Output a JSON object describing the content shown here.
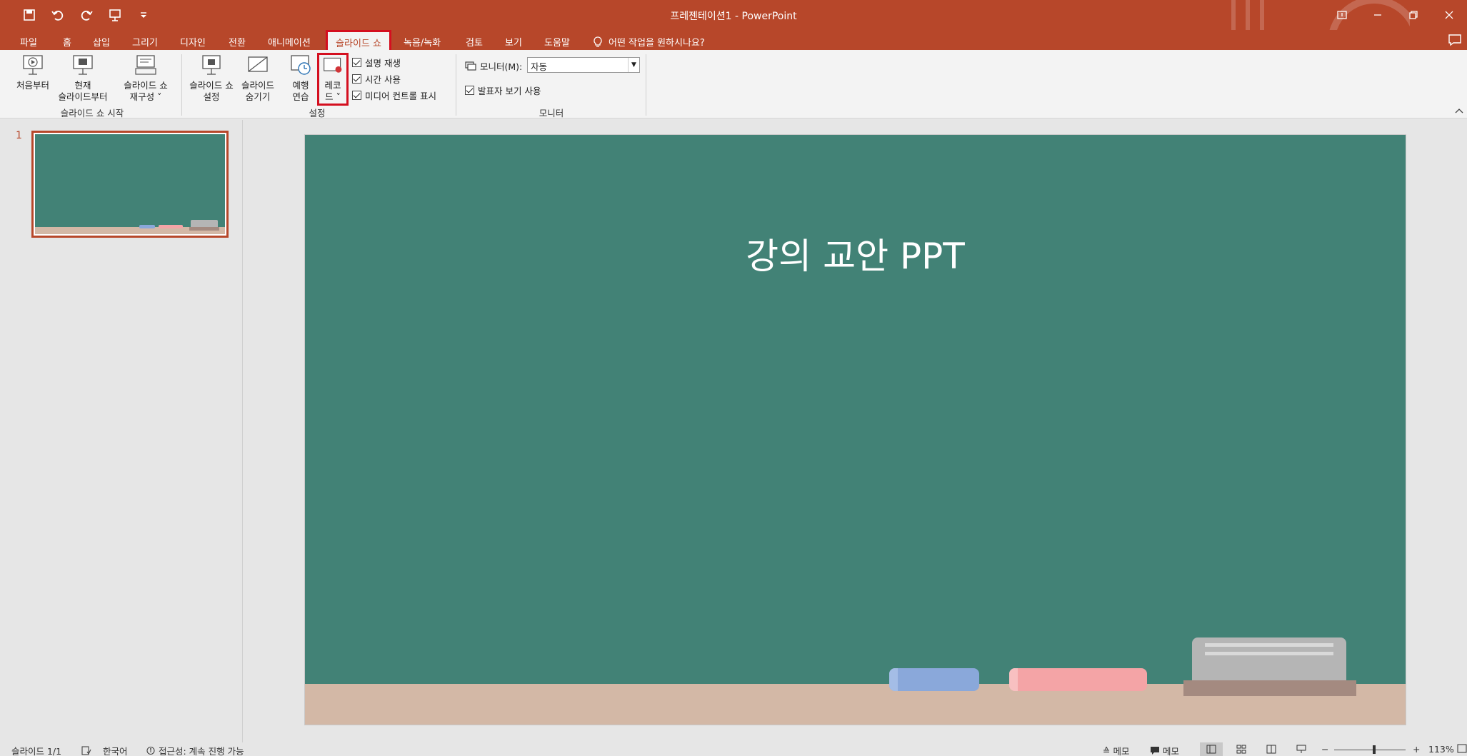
{
  "window": {
    "title": "프레젠테이션1  -  PowerPoint"
  },
  "quick_access": [
    "save-icon",
    "undo-icon",
    "redo-icon",
    "present-from-start-icon",
    "customize-qat-icon"
  ],
  "tabs": [
    {
      "label": "파일"
    },
    {
      "label": "홈"
    },
    {
      "label": "삽입"
    },
    {
      "label": "그리기"
    },
    {
      "label": "디자인"
    },
    {
      "label": "전환"
    },
    {
      "label": "애니메이션"
    },
    {
      "label": "슬라이드 쇼",
      "active": true
    },
    {
      "label": "녹음/녹화"
    },
    {
      "label": "검토"
    },
    {
      "label": "보기"
    },
    {
      "label": "도움말"
    }
  ],
  "tell_me": "어떤 작업을 원하시나요?",
  "ribbon": {
    "start_group": {
      "label": "슬라이드 쇼 시작",
      "from_beginning": "처음부터",
      "from_current_1": "현재",
      "from_current_2": "슬라이드부터",
      "custom_1": "슬라이드 쇼",
      "custom_2": "재구성 ˅"
    },
    "setup_group": {
      "label": "설정",
      "setup_1": "슬라이드 쇼",
      "setup_2": "설정",
      "hide_1": "슬라이드",
      "hide_2": "숨기기",
      "rehearse_1": "예행",
      "rehearse_2": "연습",
      "record_1": "레코",
      "record_2": "드 ˅",
      "play_narrations": "설명 재생",
      "use_timings": "시간 사용",
      "show_media_controls": "미디어 컨트롤 표시"
    },
    "monitor_group": {
      "label": "모니터",
      "monitor_label": "모니터(M):",
      "monitor_value": "자동",
      "presenter_view": "발표자 보기 사용"
    }
  },
  "thumbnails": [
    {
      "number": "1"
    }
  ],
  "slide": {
    "title": "강의 교안 PPT"
  },
  "statusbar": {
    "slide_count": "슬라이드 1/1",
    "language": "한국어",
    "accessibility": "접근성: 계속 진행 가능",
    "notes": "메모",
    "comments": "메모",
    "zoom_minus": "−",
    "zoom_plus": "+",
    "zoom": "113%"
  },
  "colors": {
    "accent": "#b7472a",
    "highlight": "#d40f1f",
    "chalkboard": "#428276",
    "ledge": "#d3b8a6"
  }
}
